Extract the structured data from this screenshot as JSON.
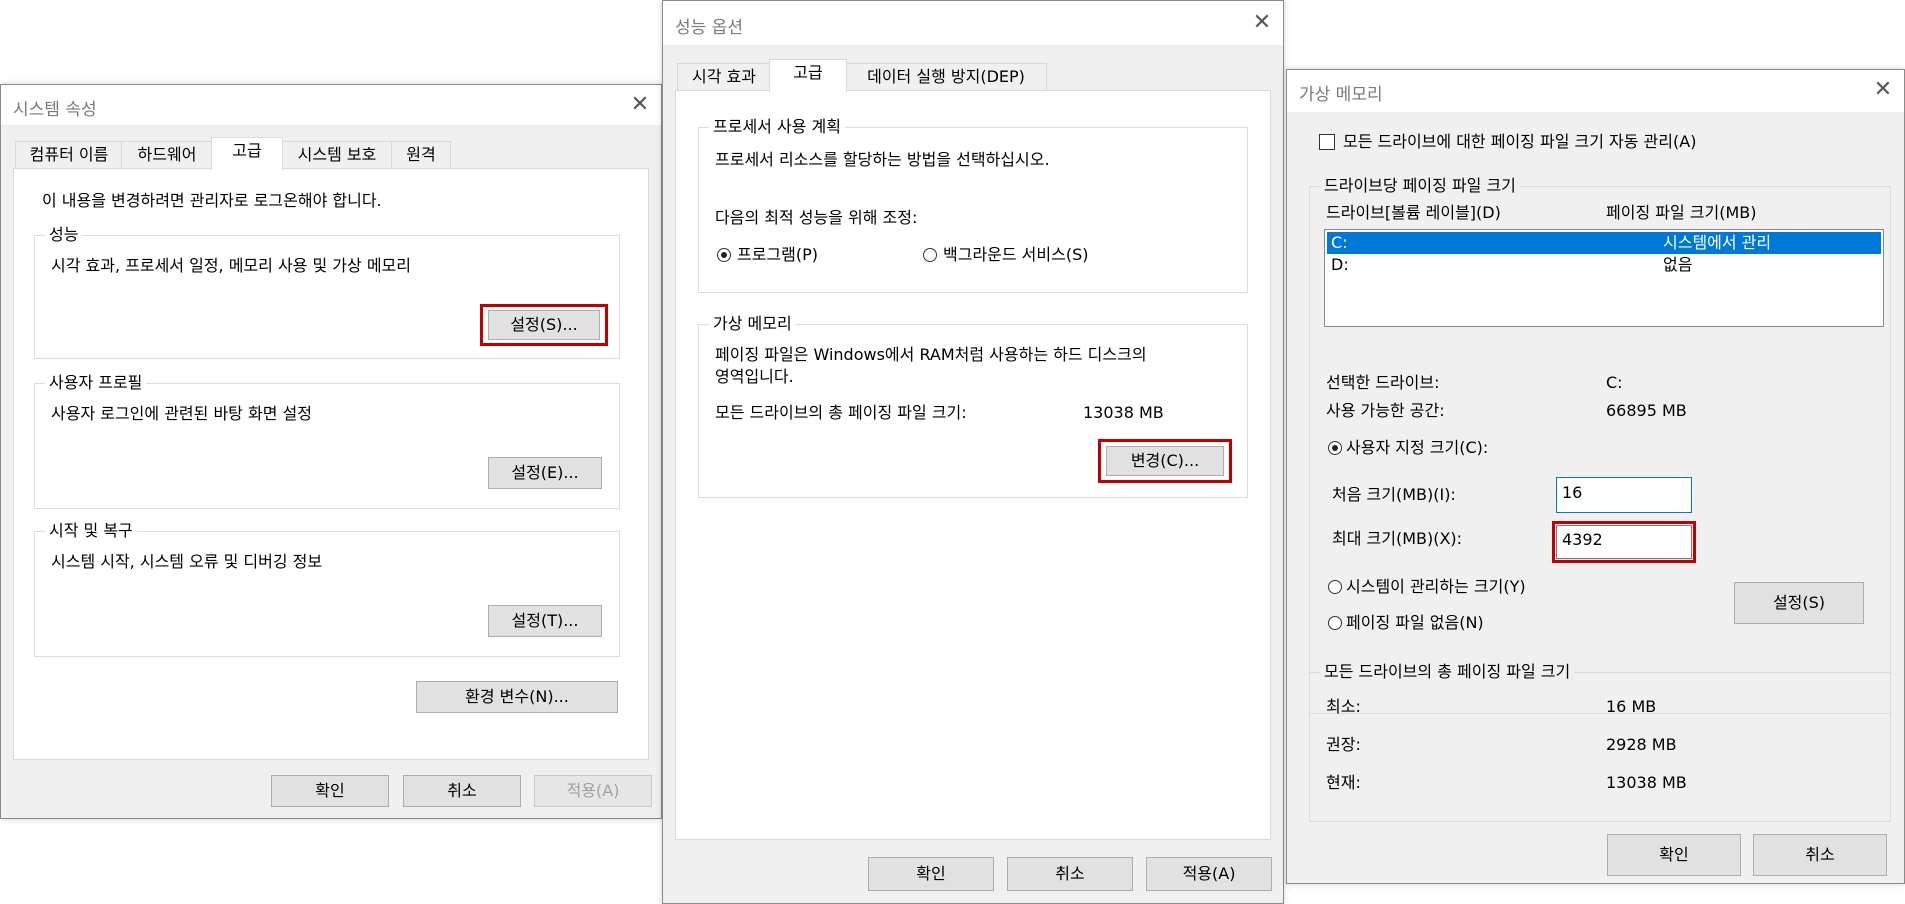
{
  "win1": {
    "title": "시스템 속성",
    "tabs": [
      "컴퓨터 이름",
      "하드웨어",
      "고급",
      "시스템 보호",
      "원격"
    ],
    "admin_note": "이 내용을 변경하려면 관리자로 로그온해야 합니다.",
    "groups": [
      {
        "title": "성능",
        "desc": "시각 효과, 프로세서 일정, 메모리 사용 및 가상 메모리",
        "button": "설정(S)..."
      },
      {
        "title": "사용자 프로필",
        "desc": "사용자 로그인에 관련된 바탕 화면 설정",
        "button": "설정(E)..."
      },
      {
        "title": "시작 및 복구",
        "desc": "시스템 시작, 시스템 오류 및 디버깅 정보",
        "button": "설정(T)..."
      }
    ],
    "env_button": "환경 변수(N)...",
    "ok": "확인",
    "cancel": "취소",
    "apply": "적용(A)"
  },
  "win2": {
    "title": "성능 옵션",
    "tabs": [
      "시각 효과",
      "고급",
      "데이터 실행 방지(DEP)"
    ],
    "proc_group": {
      "title": "프로세서 사용 계획",
      "desc": "프로세서 리소스를 할당하는 방법을 선택하십시오.",
      "adjust_label": "다음의 최적 성능을 위해 조정:",
      "opt_programs": "프로그램(P)",
      "opt_background": "백그라운드 서비스(S)",
      "selected": "프로그램(P)"
    },
    "vm_group": {
      "title": "가상 메모리",
      "desc_line1": "페이징 파일은 Windows에서 RAM처럼 사용하는 하드 디스크의",
      "desc_line2": "영역입니다.",
      "total_label": "모든 드라이브의 총 페이징 파일 크기:",
      "total_value": "13038 MB",
      "change_button": "변경(C)..."
    },
    "ok": "확인",
    "cancel": "취소",
    "apply": "적용(A)"
  },
  "win3": {
    "title": "가상 메모리",
    "auto_manage_label": "모든 드라이브에 대한 페이징 파일 크기 자동 관리(A)",
    "auto_manage_checked": false,
    "per_drive": {
      "title": "드라이브당 페이징 파일 크기",
      "col_drive": "드라이브[볼륨 레이블](D)",
      "col_size": "페이징 파일 크기(MB)",
      "rows": [
        {
          "drive": "C:",
          "size": "시스템에서 관리"
        },
        {
          "drive": "D:",
          "size": "없음"
        }
      ],
      "selected_drive_label": "선택한 드라이브:",
      "selected_drive_value": "C:",
      "available_label": "사용 가능한 공간:",
      "available_value": "66895 MB",
      "opt_custom": "사용자 지정 크기(C):",
      "initial_label": "처음 크기(MB)(I):",
      "initial_value": "16",
      "max_label": "최대 크기(MB)(X):",
      "max_value": "4392",
      "opt_system": "시스템이 관리하는 크기(Y)",
      "opt_none": "페이징 파일 없음(N)",
      "set_button": "설정(S)"
    },
    "total": {
      "title": "모든 드라이브의 총 페이징 파일 크기",
      "min_label": "최소:",
      "min_value": "16 MB",
      "rec_label": "권장:",
      "rec_value": "2928 MB",
      "cur_label": "현재:",
      "cur_value": "13038 MB"
    },
    "ok": "확인",
    "cancel": "취소"
  },
  "colors": {
    "highlight": "#c00000",
    "selection": "#0078d7",
    "dialog_bg": "#f0f0f0"
  }
}
